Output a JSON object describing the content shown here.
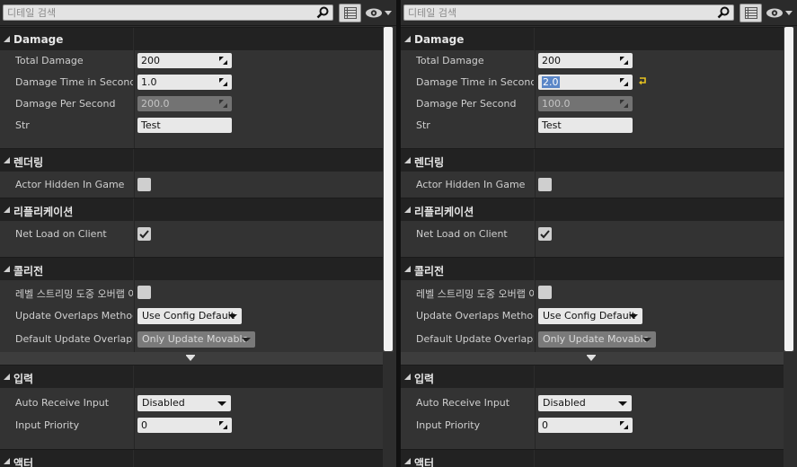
{
  "panels": [
    {
      "search_placeholder": "디테일 검색",
      "categories": {
        "damage": "Damage",
        "rendering": "렌더링",
        "replication": "리플리케이션",
        "collision": "콜리전",
        "input": "입력",
        "actor": "액터"
      },
      "props": {
        "total_damage": {
          "label": "Total Damage",
          "value": "200"
        },
        "damage_time": {
          "label": "Damage Time in Seconds",
          "value": "1.0"
        },
        "damage_per_second": {
          "label": "Damage Per Second",
          "value": "200.0"
        },
        "str": {
          "label": "Str",
          "value": "Test"
        },
        "actor_hidden": {
          "label": "Actor Hidden In Game",
          "checked": false
        },
        "net_load": {
          "label": "Net Load on Client",
          "checked": true
        },
        "level_streaming": {
          "label": "레벨 스트리밍 도중 오버랩 이",
          "checked": false
        },
        "update_overlaps": {
          "label": "Update Overlaps Method D",
          "value": "Use Config Default"
        },
        "default_update_overlaps": {
          "label": "Default Update Overlaps M",
          "value": "Only Update Movable"
        },
        "auto_receive_input": {
          "label": "Auto Receive Input",
          "value": "Disabled"
        },
        "input_priority": {
          "label": "Input Priority",
          "value": "0"
        }
      }
    },
    {
      "search_placeholder": "디테일 검색",
      "categories": {
        "damage": "Damage",
        "rendering": "렌더링",
        "replication": "리플리케이션",
        "collision": "콜리전",
        "input": "입력",
        "actor": "액터"
      },
      "props": {
        "total_damage": {
          "label": "Total Damage",
          "value": "200"
        },
        "damage_time": {
          "label": "Damage Time in Seconds",
          "value": "2.0"
        },
        "damage_per_second": {
          "label": "Damage Per Second",
          "value": "100.0"
        },
        "str": {
          "label": "Str",
          "value": "Test"
        },
        "actor_hidden": {
          "label": "Actor Hidden In Game",
          "checked": false
        },
        "net_load": {
          "label": "Net Load on Client",
          "checked": true
        },
        "level_streaming": {
          "label": "레벨 스트리밍 도중 오버랩 이",
          "checked": false
        },
        "update_overlaps": {
          "label": "Update Overlaps Method D",
          "value": "Use Config Default"
        },
        "default_update_overlaps": {
          "label": "Default Update Overlaps M",
          "value": "Only Update Movable"
        },
        "auto_receive_input": {
          "label": "Auto Receive Input",
          "value": "Disabled"
        },
        "input_priority": {
          "label": "Input Priority",
          "value": "0"
        }
      }
    }
  ],
  "icons": {
    "search": "magnifier-icon",
    "view_options": "list-view-icon",
    "visibility": "eye-icon",
    "drag": "drag-handle-icon",
    "checkbox_check": "checkmark-icon",
    "reset": "reset-to-default-icon",
    "expand": "expand-advanced-icon"
  }
}
